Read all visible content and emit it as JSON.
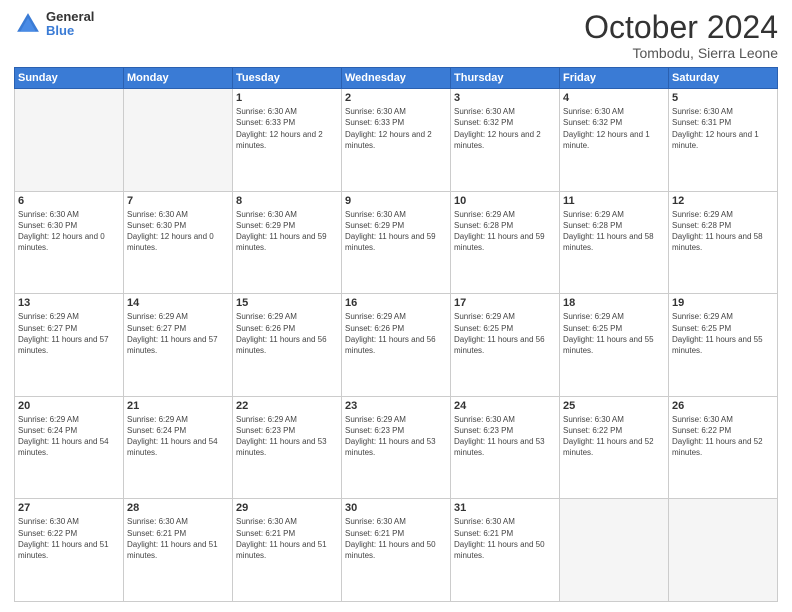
{
  "header": {
    "logo_line1": "General",
    "logo_line2": "Blue",
    "month": "October 2024",
    "location": "Tombodu, Sierra Leone"
  },
  "weekdays": [
    "Sunday",
    "Monday",
    "Tuesday",
    "Wednesday",
    "Thursday",
    "Friday",
    "Saturday"
  ],
  "weeks": [
    [
      {
        "day": "",
        "info": ""
      },
      {
        "day": "",
        "info": ""
      },
      {
        "day": "1",
        "info": "Sunrise: 6:30 AM\nSunset: 6:33 PM\nDaylight: 12 hours and 2 minutes."
      },
      {
        "day": "2",
        "info": "Sunrise: 6:30 AM\nSunset: 6:33 PM\nDaylight: 12 hours and 2 minutes."
      },
      {
        "day": "3",
        "info": "Sunrise: 6:30 AM\nSunset: 6:32 PM\nDaylight: 12 hours and 2 minutes."
      },
      {
        "day": "4",
        "info": "Sunrise: 6:30 AM\nSunset: 6:32 PM\nDaylight: 12 hours and 1 minute."
      },
      {
        "day": "5",
        "info": "Sunrise: 6:30 AM\nSunset: 6:31 PM\nDaylight: 12 hours and 1 minute."
      }
    ],
    [
      {
        "day": "6",
        "info": "Sunrise: 6:30 AM\nSunset: 6:30 PM\nDaylight: 12 hours and 0 minutes."
      },
      {
        "day": "7",
        "info": "Sunrise: 6:30 AM\nSunset: 6:30 PM\nDaylight: 12 hours and 0 minutes."
      },
      {
        "day": "8",
        "info": "Sunrise: 6:30 AM\nSunset: 6:29 PM\nDaylight: 11 hours and 59 minutes."
      },
      {
        "day": "9",
        "info": "Sunrise: 6:30 AM\nSunset: 6:29 PM\nDaylight: 11 hours and 59 minutes."
      },
      {
        "day": "10",
        "info": "Sunrise: 6:29 AM\nSunset: 6:28 PM\nDaylight: 11 hours and 59 minutes."
      },
      {
        "day": "11",
        "info": "Sunrise: 6:29 AM\nSunset: 6:28 PM\nDaylight: 11 hours and 58 minutes."
      },
      {
        "day": "12",
        "info": "Sunrise: 6:29 AM\nSunset: 6:28 PM\nDaylight: 11 hours and 58 minutes."
      }
    ],
    [
      {
        "day": "13",
        "info": "Sunrise: 6:29 AM\nSunset: 6:27 PM\nDaylight: 11 hours and 57 minutes."
      },
      {
        "day": "14",
        "info": "Sunrise: 6:29 AM\nSunset: 6:27 PM\nDaylight: 11 hours and 57 minutes."
      },
      {
        "day": "15",
        "info": "Sunrise: 6:29 AM\nSunset: 6:26 PM\nDaylight: 11 hours and 56 minutes."
      },
      {
        "day": "16",
        "info": "Sunrise: 6:29 AM\nSunset: 6:26 PM\nDaylight: 11 hours and 56 minutes."
      },
      {
        "day": "17",
        "info": "Sunrise: 6:29 AM\nSunset: 6:25 PM\nDaylight: 11 hours and 56 minutes."
      },
      {
        "day": "18",
        "info": "Sunrise: 6:29 AM\nSunset: 6:25 PM\nDaylight: 11 hours and 55 minutes."
      },
      {
        "day": "19",
        "info": "Sunrise: 6:29 AM\nSunset: 6:25 PM\nDaylight: 11 hours and 55 minutes."
      }
    ],
    [
      {
        "day": "20",
        "info": "Sunrise: 6:29 AM\nSunset: 6:24 PM\nDaylight: 11 hours and 54 minutes."
      },
      {
        "day": "21",
        "info": "Sunrise: 6:29 AM\nSunset: 6:24 PM\nDaylight: 11 hours and 54 minutes."
      },
      {
        "day": "22",
        "info": "Sunrise: 6:29 AM\nSunset: 6:23 PM\nDaylight: 11 hours and 53 minutes."
      },
      {
        "day": "23",
        "info": "Sunrise: 6:29 AM\nSunset: 6:23 PM\nDaylight: 11 hours and 53 minutes."
      },
      {
        "day": "24",
        "info": "Sunrise: 6:30 AM\nSunset: 6:23 PM\nDaylight: 11 hours and 53 minutes."
      },
      {
        "day": "25",
        "info": "Sunrise: 6:30 AM\nSunset: 6:22 PM\nDaylight: 11 hours and 52 minutes."
      },
      {
        "day": "26",
        "info": "Sunrise: 6:30 AM\nSunset: 6:22 PM\nDaylight: 11 hours and 52 minutes."
      }
    ],
    [
      {
        "day": "27",
        "info": "Sunrise: 6:30 AM\nSunset: 6:22 PM\nDaylight: 11 hours and 51 minutes."
      },
      {
        "day": "28",
        "info": "Sunrise: 6:30 AM\nSunset: 6:21 PM\nDaylight: 11 hours and 51 minutes."
      },
      {
        "day": "29",
        "info": "Sunrise: 6:30 AM\nSunset: 6:21 PM\nDaylight: 11 hours and 51 minutes."
      },
      {
        "day": "30",
        "info": "Sunrise: 6:30 AM\nSunset: 6:21 PM\nDaylight: 11 hours and 50 minutes."
      },
      {
        "day": "31",
        "info": "Sunrise: 6:30 AM\nSunset: 6:21 PM\nDaylight: 11 hours and 50 minutes."
      },
      {
        "day": "",
        "info": ""
      },
      {
        "day": "",
        "info": ""
      }
    ]
  ]
}
